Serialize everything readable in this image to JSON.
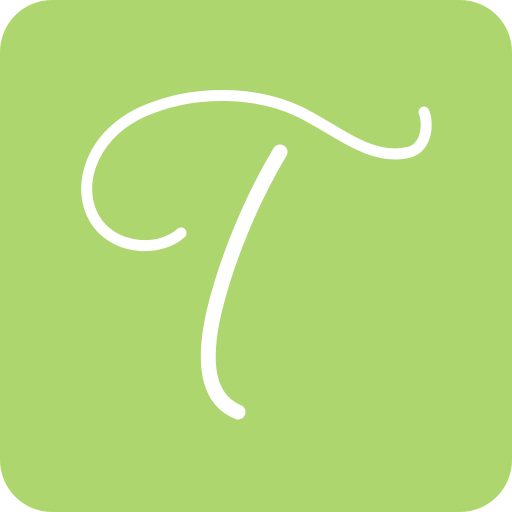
{
  "icon": {
    "name": "app-icon",
    "glyph": "T",
    "glyph_style": "script-letter-t",
    "colors": {
      "background": "#aed66f",
      "glyph": "#ffffff"
    }
  }
}
